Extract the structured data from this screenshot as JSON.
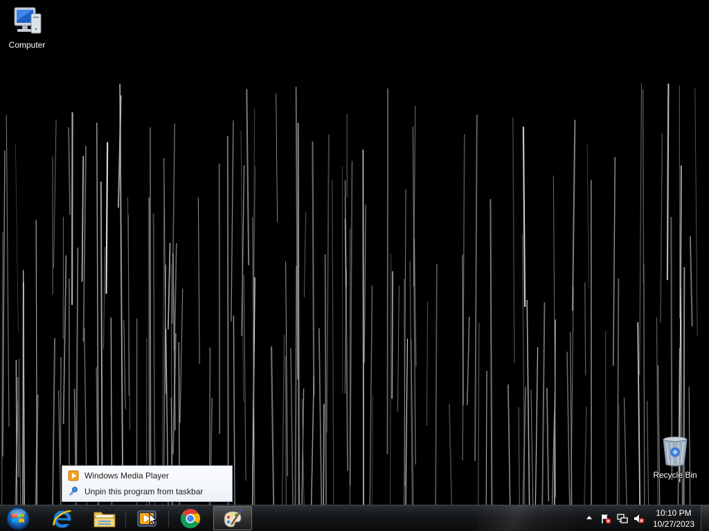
{
  "desktop": {
    "icons": [
      {
        "label": "Computer"
      },
      {
        "label": "Recycle Bin"
      }
    ]
  },
  "jumplist": {
    "items": [
      {
        "label": "Windows Media Player",
        "icon": "wmp-icon"
      },
      {
        "label": "Unpin this program from taskbar",
        "icon": "unpin-icon"
      }
    ]
  },
  "taskbar": {
    "start": {
      "icon": "windows-start-orb"
    },
    "pinned": [
      {
        "name": "Internet Explorer",
        "icon": "ie-icon"
      },
      {
        "name": "Windows Explorer",
        "icon": "folder-icon"
      },
      {
        "name": "Windows Media Player",
        "icon": "wmp-icon"
      },
      {
        "name": "Google Chrome",
        "icon": "chrome-icon"
      },
      {
        "name": "Paint",
        "icon": "paint-icon",
        "active": true
      }
    ],
    "tray": {
      "icons": [
        "show-hidden-icons-arrow",
        "action-center-flag-icon",
        "network-icon",
        "volume-muted-icon"
      ],
      "time": "10:10 PM",
      "date": "10/27/2023"
    }
  },
  "colors": {
    "desktop_bg": "#000000",
    "taskbar_bg": "#141618",
    "menu_bg": "#f3f6fb",
    "menu_border": "#9aa6b8"
  }
}
